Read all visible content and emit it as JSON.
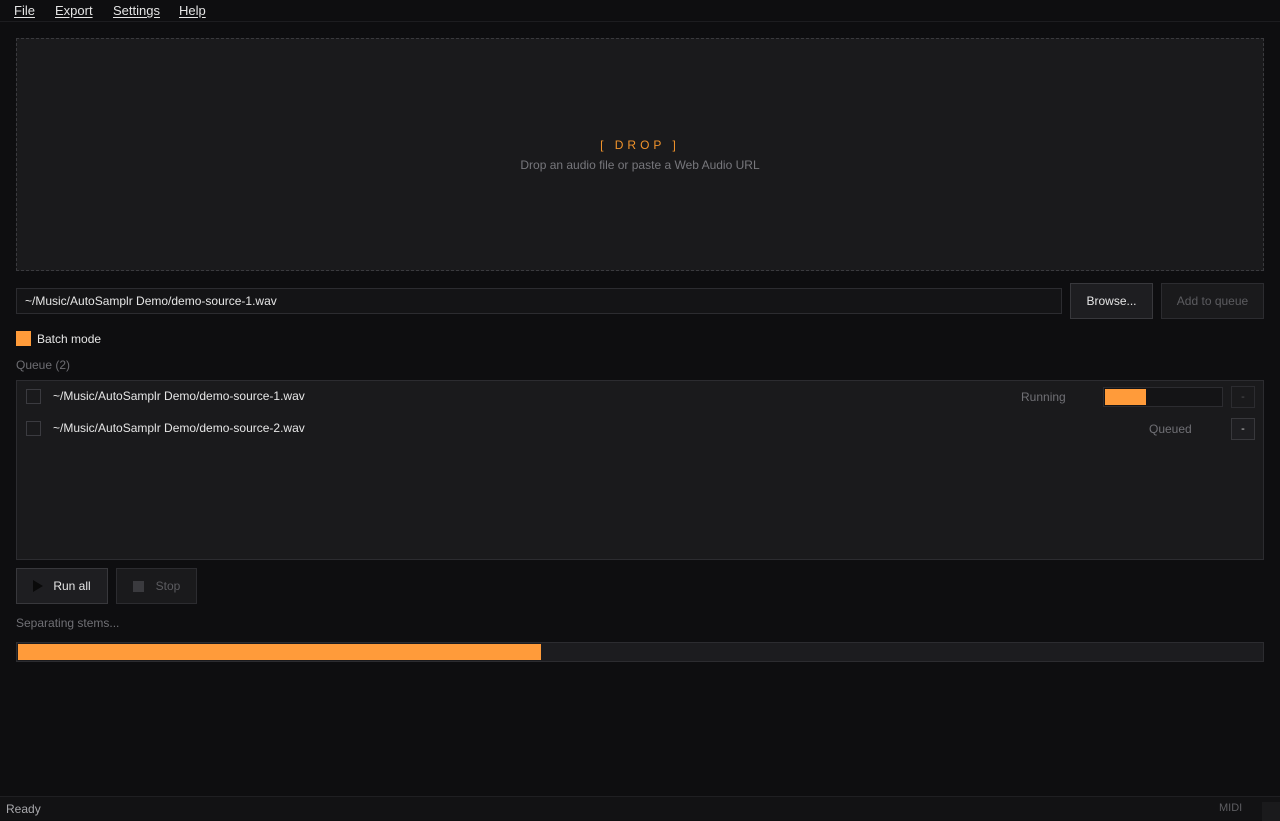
{
  "menu": {
    "items": [
      "File",
      "Export",
      "Settings",
      "Help"
    ]
  },
  "dropzone": {
    "title": "[ DROP ]",
    "hint": "Drop an audio file or paste a Web Audio URL"
  },
  "source": {
    "path_value": "~/Music/AutoSamplr Demo/demo-source-1.wav",
    "browse_label": "Browse...",
    "add_to_queue_label": "Add to queue"
  },
  "batch": {
    "label": "Batch mode",
    "checked": true
  },
  "queue": {
    "label": "Queue (2)",
    "items": [
      {
        "path": "~/Music/AutoSamplr Demo/demo-source-1.wav",
        "status": "Running",
        "progress": 0.35,
        "remove_label": "-"
      },
      {
        "path": "~/Music/AutoSamplr Demo/demo-source-2.wav",
        "status": "Queued",
        "remove_label": "-"
      }
    ]
  },
  "controls": {
    "run_all_label": "Run all",
    "stop_label": "Stop"
  },
  "progress": {
    "label": "Separating stems...",
    "value": 0.42
  },
  "statusbar": {
    "status": "Ready",
    "midi": "MIDI"
  },
  "colors": {
    "accent": "#ff9b3a",
    "background": "#0e0e10",
    "panel": "#1a1a1c"
  }
}
